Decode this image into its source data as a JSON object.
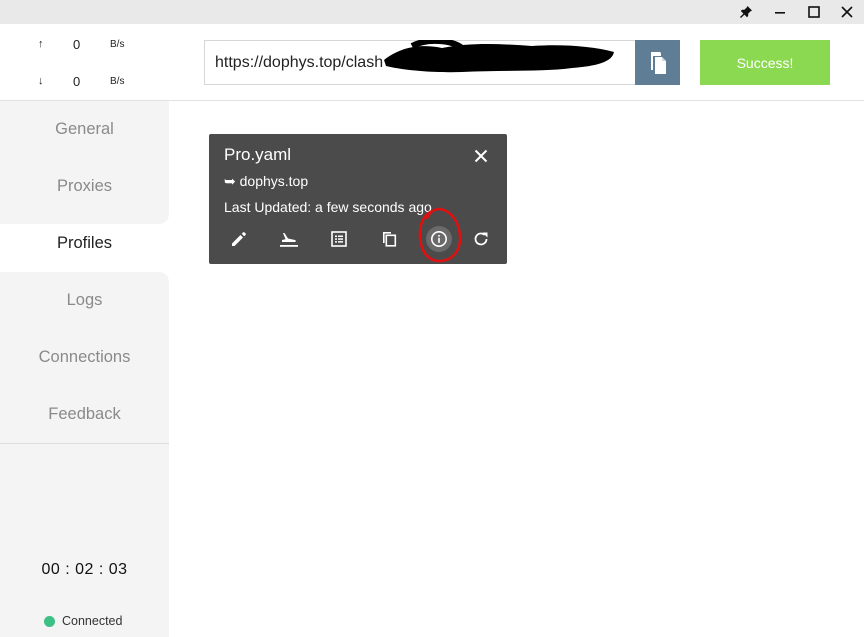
{
  "titlebar": {
    "icons": [
      "pin-icon",
      "minimize-icon",
      "maximize-icon",
      "close-icon"
    ]
  },
  "traffic": {
    "upload": {
      "arrow": "↑",
      "value": "0",
      "unit": "B/s"
    },
    "download": {
      "arrow": "↓",
      "value": "0",
      "unit": "B/s"
    }
  },
  "nav": {
    "items": [
      {
        "label": "General"
      },
      {
        "label": "Proxies"
      },
      {
        "label": "Profiles"
      },
      {
        "label": "Logs"
      },
      {
        "label": "Connections"
      },
      {
        "label": "Feedback"
      }
    ],
    "active": "Profiles"
  },
  "footer": {
    "timer": "00 : 02 : 03",
    "status": "Connected",
    "status_color": "#3cc084"
  },
  "header": {
    "url_value": "https://dophys.top/clash",
    "copy_icon": "copy-icon",
    "success_label": "Success!",
    "success_color": "#8bd950",
    "copy_color": "#5f7e95"
  },
  "profile_card": {
    "name": "Pro.yaml",
    "host": "➥ dophys.top",
    "updated": "Last Updated: a few seconds ago",
    "actions": [
      "edit-icon",
      "flight-land-icon",
      "list-icon",
      "duplicate-icon",
      "info-icon",
      "refresh-icon"
    ]
  }
}
